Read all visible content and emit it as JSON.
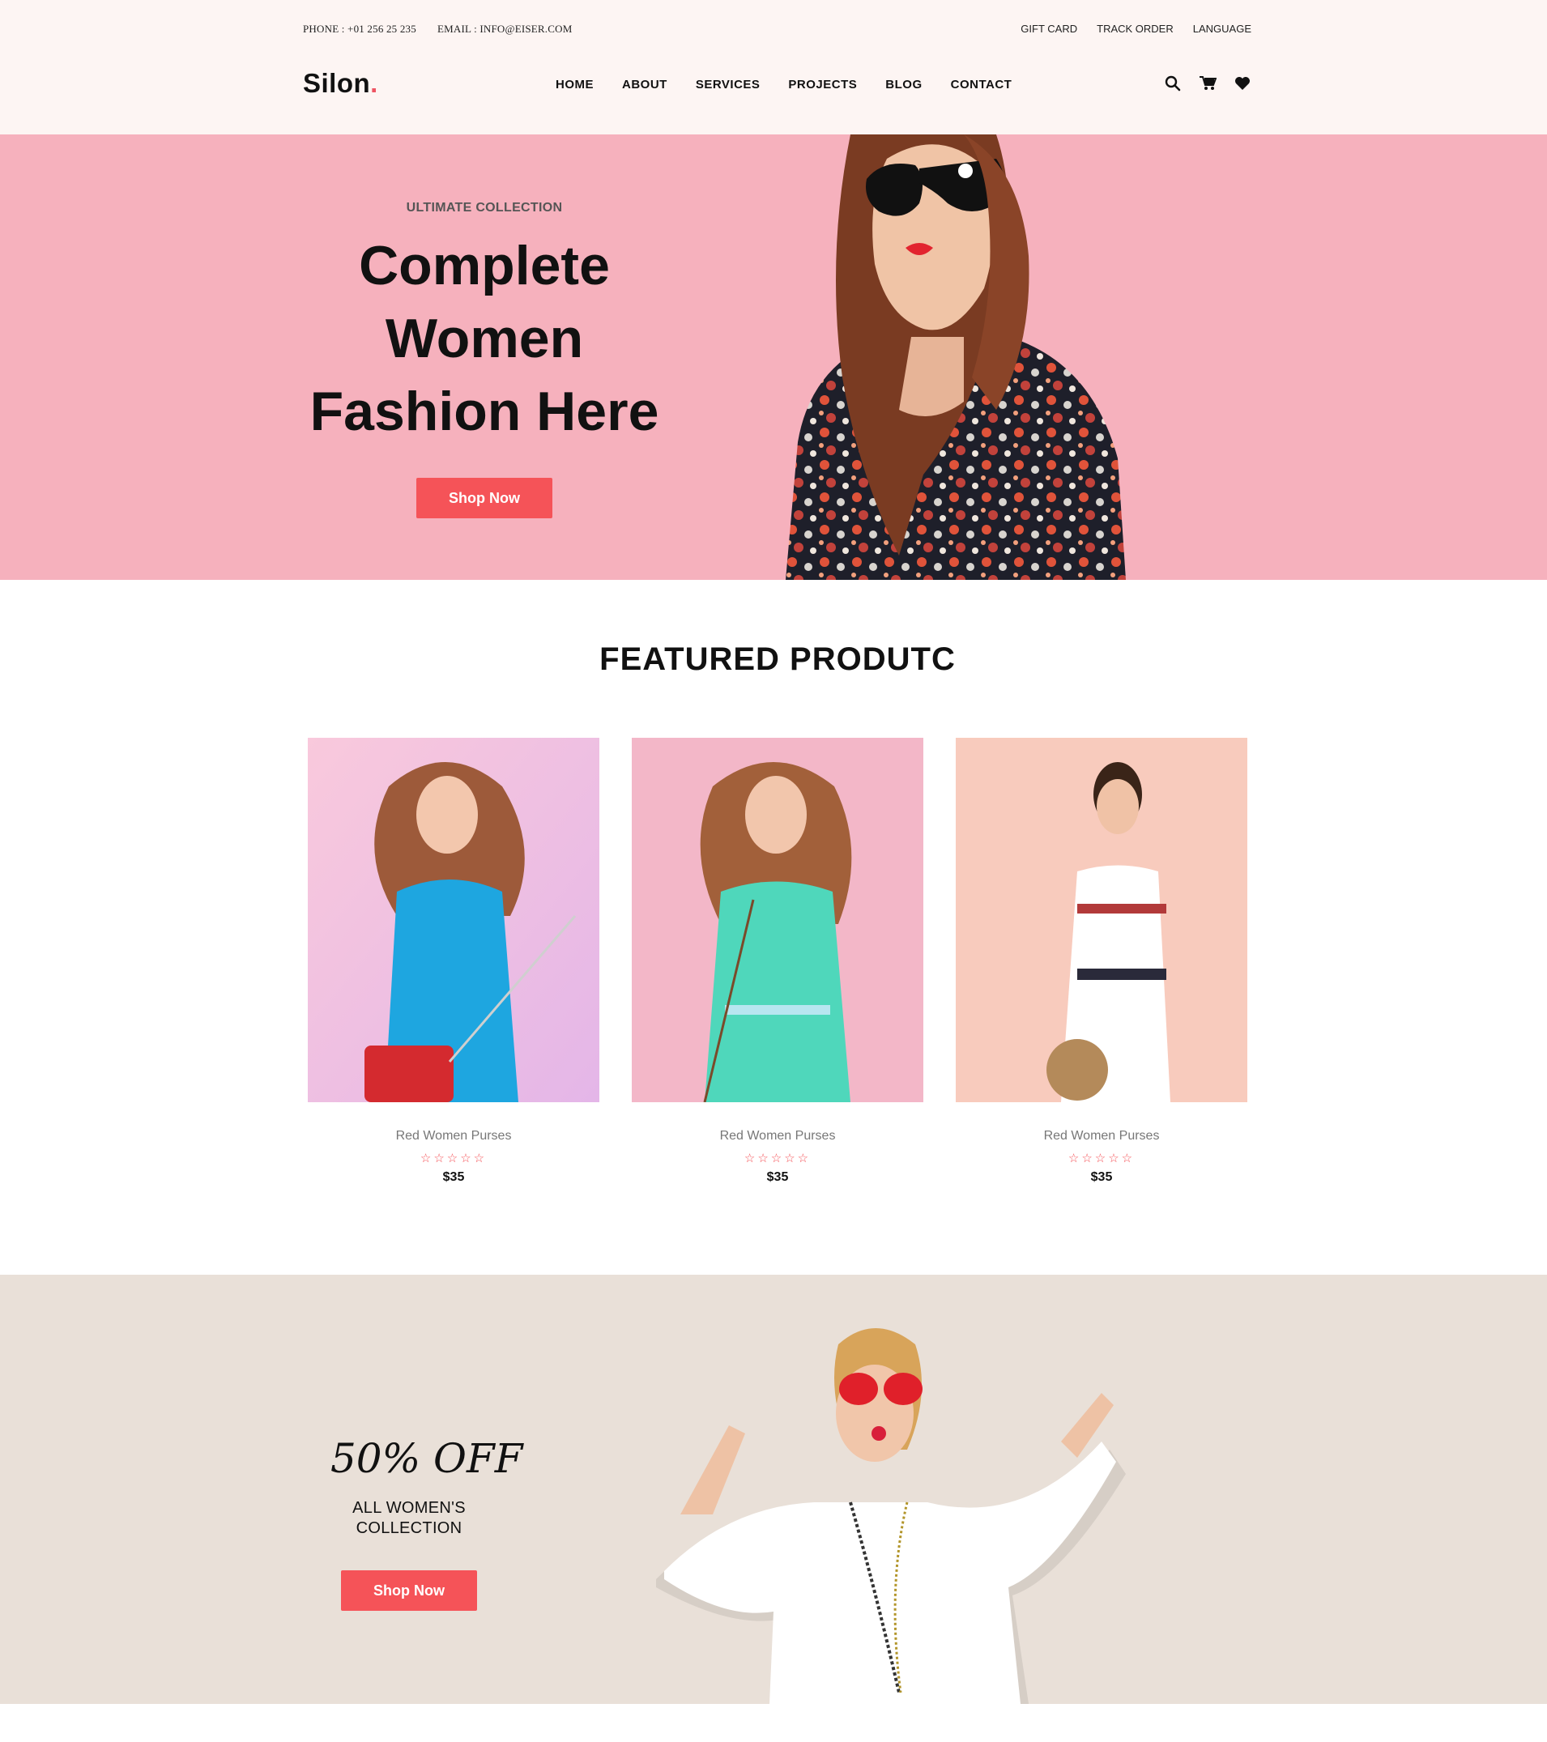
{
  "header": {
    "phone": "PHONE : +01 256 25 235",
    "email": "EMAIL : INFO@EISER.COM",
    "top_links": [
      "GIFT CARD",
      "TRACK ORDER",
      "LANGUAGE"
    ],
    "logo": "Silon",
    "logo_dot": ".",
    "logo_dot_color": "#ee5462",
    "nav": [
      "HOME",
      "ABOUT",
      "SERVICES",
      "PROJECTS",
      "BLOG",
      "CONTACT"
    ],
    "icons": [
      "search-icon",
      "cart-icon",
      "heart-icon"
    ]
  },
  "hero": {
    "eyebrow": "ULTIMATE COLLECTION",
    "title_lines": [
      "Complete",
      "Women",
      "Fashion Here"
    ],
    "button": "Shop Now",
    "background": "#f6b1bd",
    "accent": "#f55358"
  },
  "featured": {
    "title": "FEATURED PRODUTC",
    "products": [
      {
        "name": "Red Women Purses",
        "stars": "☆☆☆☆☆",
        "price": "$35"
      },
      {
        "name": "Red Women Purses",
        "stars": "☆☆☆☆☆",
        "price": "$35"
      },
      {
        "name": "Red Women Purses",
        "stars": "☆☆☆☆☆",
        "price": "$35"
      }
    ]
  },
  "promo": {
    "headline": "50% OFF",
    "subtitle_lines": [
      "ALL WOMEN'S",
      "COLLECTION"
    ],
    "button": "Shop Now",
    "background": "#e9e0d8"
  }
}
